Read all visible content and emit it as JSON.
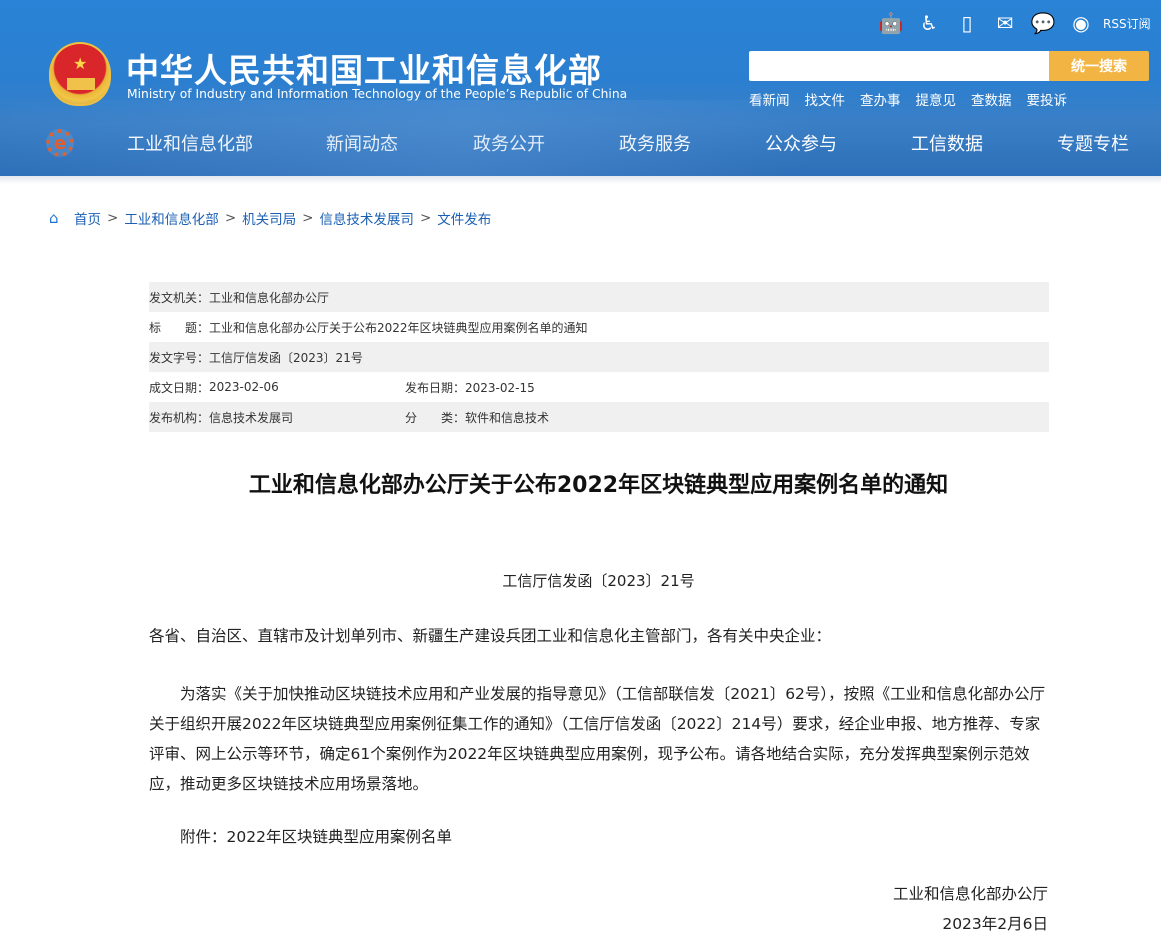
{
  "header": {
    "title_cn": "中华人民共和国工业和信息化部",
    "title_en": "Ministry of Industry and Information Technology of the People’s Republic of China",
    "rss": "RSS订阅",
    "search_placeholder": "",
    "search_button": "统一搜索",
    "quick_links": [
      "看新闻",
      "找文件",
      "查办事",
      "提意见",
      "查数据",
      "要投诉"
    ],
    "nav": [
      "工业和信息化部",
      "新闻动态",
      "政务公开",
      "政务服务",
      "公众参与",
      "工信数据",
      "专题专栏"
    ]
  },
  "breadcrumb": [
    "首页",
    "工业和信息化部",
    "机关司局",
    "信息技术发展司",
    "文件发布"
  ],
  "meta": {
    "issuer_label": "发文机关：",
    "issuer": "工业和信息化部办公厅",
    "title_label": "标　　题：",
    "title": "工业和信息化部办公厅关于公布2022年区块链典型应用案例名单的通知",
    "docno_label": "发文字号：",
    "docno": "工信厅信发函〔2023〕21号",
    "created_label": "成文日期：",
    "created": "2023-02-06",
    "published_label": "发布日期：",
    "published": "2023-02-15",
    "org_label": "发布机构：",
    "org": "信息技术发展司",
    "category_label": "分　　类：",
    "category": "软件和信息技术"
  },
  "article": {
    "title": "工业和信息化部办公厅关于公布2022年区块链典型应用案例名单的通知",
    "docno": "工信厅信发函〔2023〕21号",
    "salutation": "各省、自治区、直辖市及计划单列市、新疆生产建设兵团工业和信息化主管部门，各有关中央企业：",
    "body": "为落实《关于加快推动区块链技术应用和产业发展的指导意见》（工信部联信发〔2021〕62号），按照《工业和信息化部办公厅关于组织开展2022年区块链典型应用案例征集工作的通知》（工信厅信发函〔2022〕214号）要求，经企业申报、地方推荐、专家评审、网上公示等环节，确定61个案例作为2022年区块链典型应用案例，现予公布。请各地结合实际，充分发挥典型案例示范效应，推动更多区块链技术应用场景落地。",
    "attachment": "附件：2022年区块链典型应用案例名单",
    "signer": "工业和信息化部办公厅",
    "date": "2023年2月6日"
  }
}
